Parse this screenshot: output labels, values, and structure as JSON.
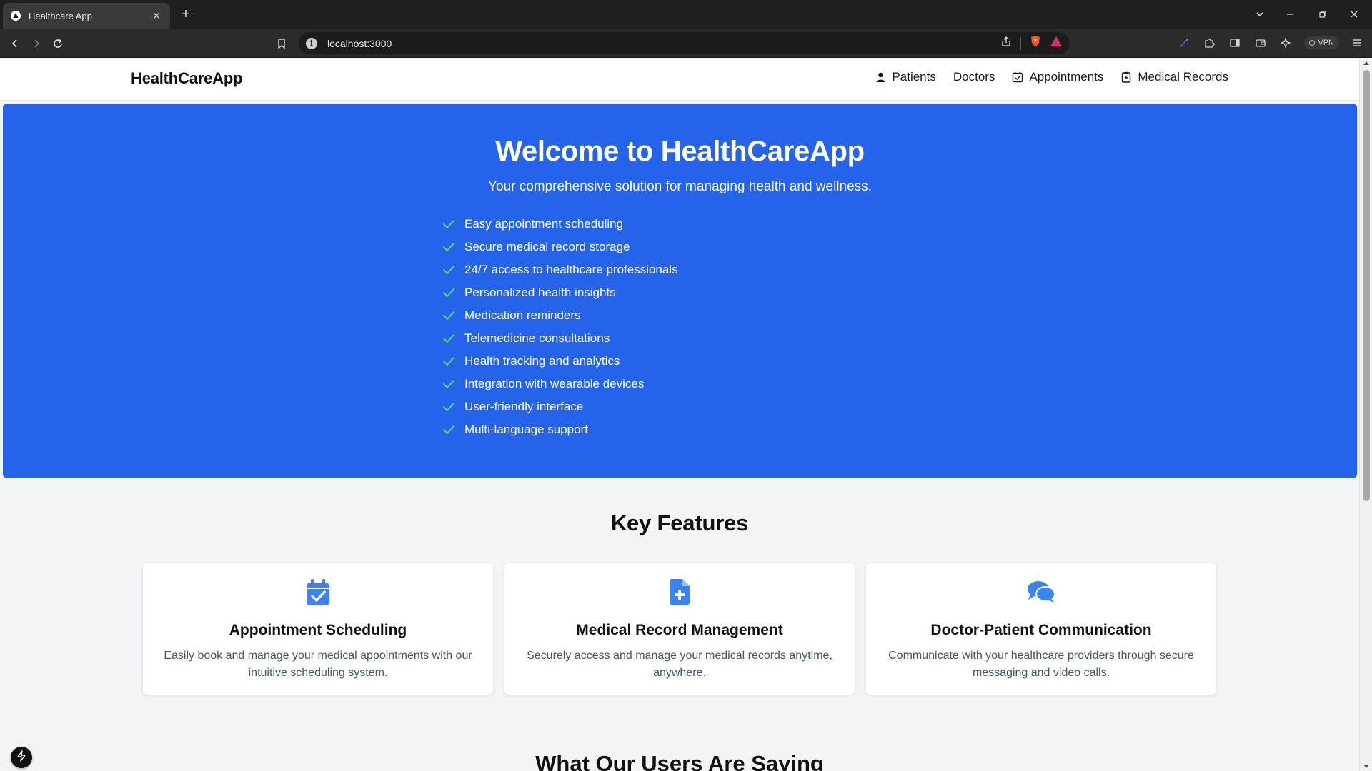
{
  "browser": {
    "tab_title": "Healthcare App",
    "url": "localhost:3000",
    "vpn_label": "VPN"
  },
  "site": {
    "brand": "HealthCareApp",
    "nav": [
      {
        "label": "Patients",
        "icon": "user-icon"
      },
      {
        "label": "Doctors",
        "icon": ""
      },
      {
        "label": "Appointments",
        "icon": "calendar-check-icon"
      },
      {
        "label": "Medical Records",
        "icon": "clipboard-icon"
      }
    ]
  },
  "hero": {
    "title": "Welcome to HealthCareApp",
    "subtitle": "Your comprehensive solution for managing health and wellness.",
    "benefits": [
      "Easy appointment scheduling",
      "Secure medical record storage",
      "24/7 access to healthcare professionals",
      "Personalized health insights",
      "Medication reminders",
      "Telemedicine consultations",
      "Health tracking and analytics",
      "Integration with wearable devices",
      "User-friendly interface",
      "Multi-language support"
    ]
  },
  "features": {
    "title": "Key Features",
    "cards": [
      {
        "icon": "calendar-check-icon",
        "title": "Appointment Scheduling",
        "text": "Easily book and manage your medical appointments with our intuitive scheduling system."
      },
      {
        "icon": "file-medical-icon",
        "title": "Medical Record Management",
        "text": "Securely access and manage your medical records anytime, anywhere."
      },
      {
        "icon": "chat-bubbles-icon",
        "title": "Doctor-Patient Communication",
        "text": "Communicate with your healthcare providers through secure messaging and video calls."
      }
    ]
  },
  "next_section": {
    "title": "What Our Users Are Saying"
  },
  "colors": {
    "primary": "#2563eb",
    "check": "#4ade80",
    "icon_blue": "#3b82f6"
  }
}
